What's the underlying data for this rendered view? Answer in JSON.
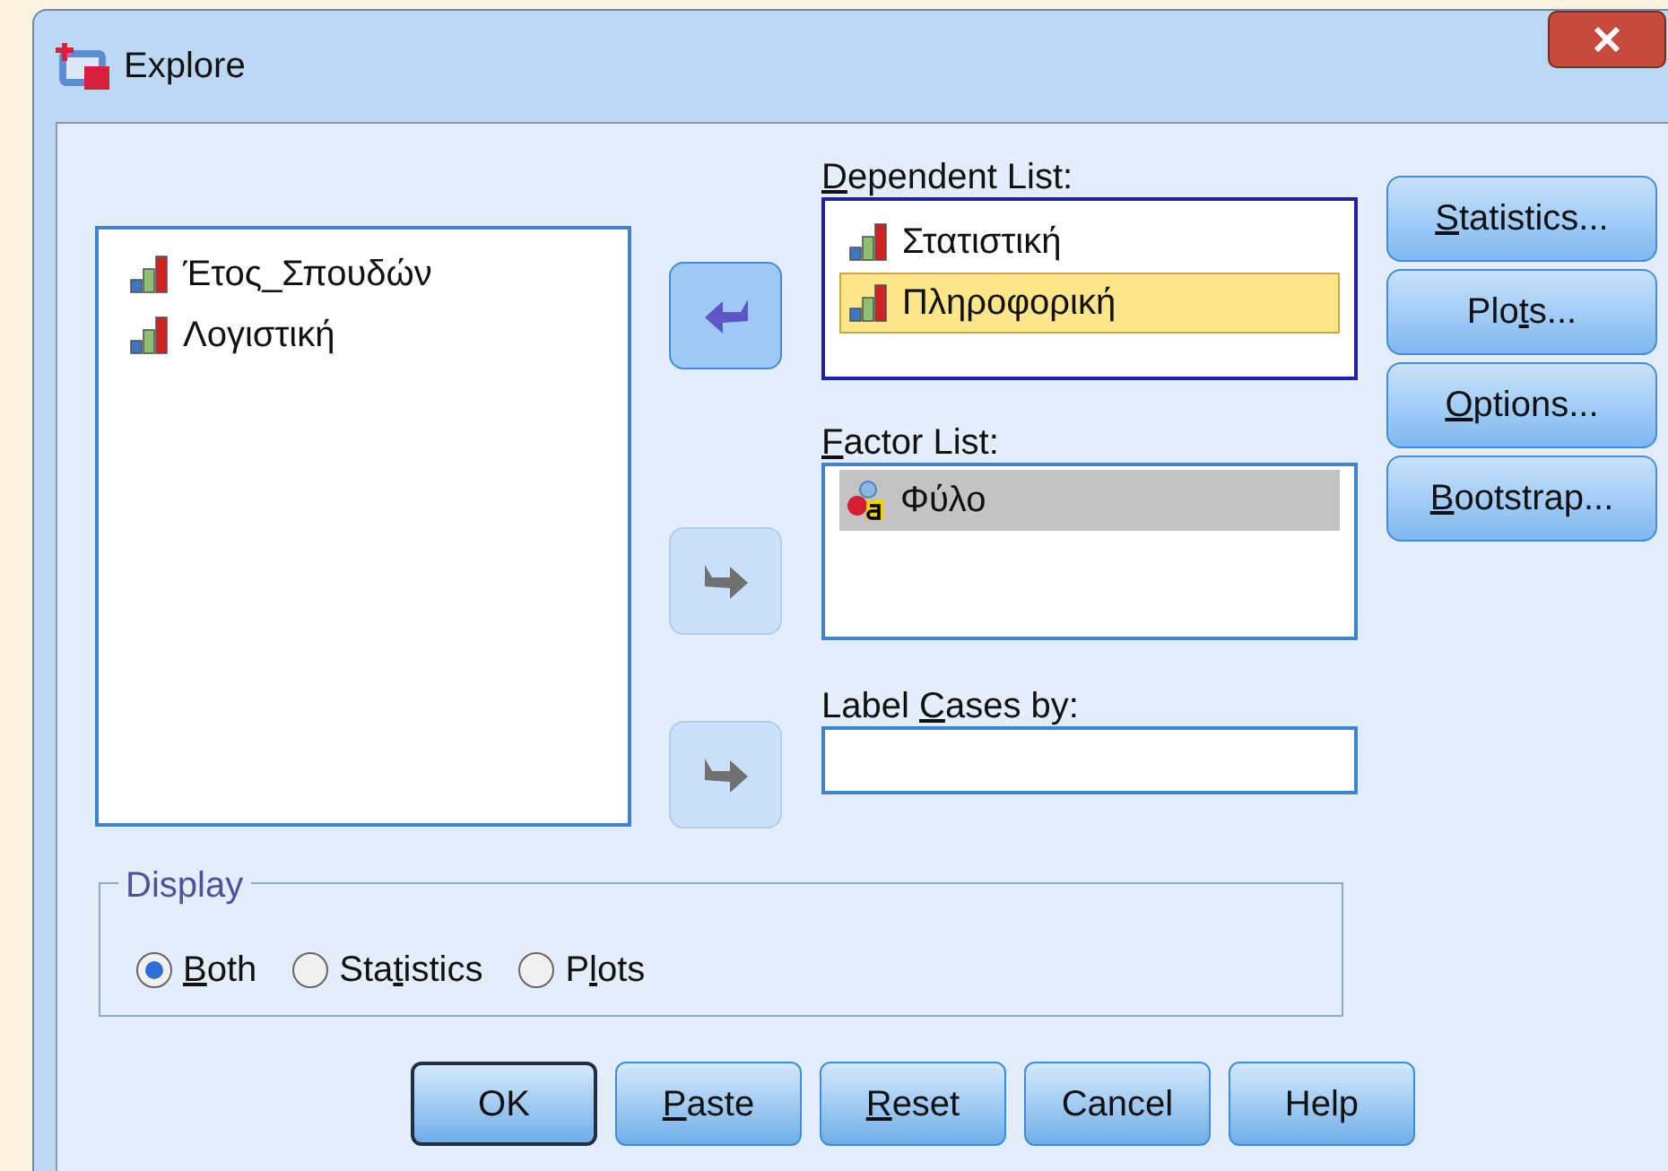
{
  "window": {
    "title": "Explore"
  },
  "source_list": {
    "items": [
      {
        "name": "Έτος_Σπουδών",
        "kind": "scale",
        "selected": false
      },
      {
        "name": "Λογιστική",
        "kind": "scale",
        "selected": false
      }
    ]
  },
  "move_buttons": [
    {
      "kind": "left",
      "disabled": false
    },
    {
      "kind": "right",
      "disabled": true
    },
    {
      "kind": "right",
      "disabled": true
    }
  ],
  "dependent_list": {
    "label": {
      "key": "D",
      "post": "ependent List:"
    },
    "focused": true,
    "items": [
      {
        "name": "Στατιστική",
        "kind": "scale",
        "selected": false
      },
      {
        "name": "Πληροφορική",
        "kind": "scale",
        "selected": true
      }
    ]
  },
  "factor_list": {
    "label": {
      "key": "F",
      "post": "actor List:"
    },
    "focused": false,
    "items": [
      {
        "name": "Φύλο",
        "kind": "nominal",
        "selected": true
      }
    ]
  },
  "label_cases": {
    "label": {
      "pre": "Label ",
      "key": "C",
      "post": "ases by:"
    }
  },
  "side_buttons": [
    {
      "key": "S",
      "post": "tatistics..."
    },
    {
      "pre": "Plo",
      "key": "t",
      "post": "s..."
    },
    {
      "key": "O",
      "post": "ptions..."
    },
    {
      "key": "B",
      "post": "ootstrap..."
    }
  ],
  "display": {
    "title": "Display",
    "options": [
      {
        "label": {
          "key": "B",
          "post": "oth"
        },
        "selected": true
      },
      {
        "label": {
          "pre": "Sta",
          "key": "t",
          "post": "istics"
        },
        "selected": false
      },
      {
        "label": {
          "pre": "P",
          "key": "l",
          "post": "ots"
        },
        "selected": false
      }
    ]
  },
  "buttons": [
    {
      "label": {
        "pre": "OK"
      },
      "default": true
    },
    {
      "label": {
        "key": "P",
        "post": "aste"
      },
      "default": false
    },
    {
      "label": {
        "key": "R",
        "post": "eset"
      },
      "default": false
    },
    {
      "label": {
        "pre": "Cancel"
      },
      "default": false
    },
    {
      "label": {
        "pre": "Help"
      },
      "default": false
    }
  ]
}
